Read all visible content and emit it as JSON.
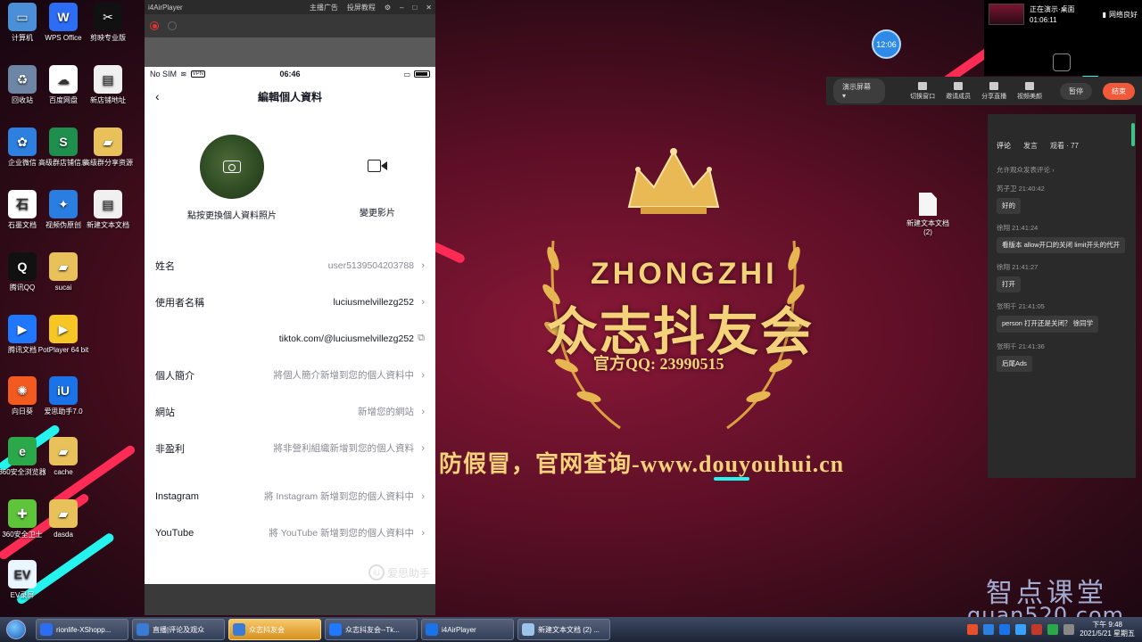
{
  "desktop_icons": [
    {
      "label": "计算机",
      "color": "#4a8fd8",
      "glyph": "▭"
    },
    {
      "label": "WPS Office",
      "color": "#2d6df6",
      "glyph": "W"
    },
    {
      "label": "剪映专业版",
      "color": "#111111",
      "glyph": "✂"
    },
    {
      "label": "回收站",
      "color": "#6e86a6",
      "glyph": "♻"
    },
    {
      "label": "百度网盘",
      "color": "#ffffff",
      "glyph": "☁"
    },
    {
      "label": "新店铺地址",
      "color": "#f0f0f0",
      "glyph": "▤"
    },
    {
      "label": "企业微信",
      "color": "#2d7fe0",
      "glyph": "✿"
    },
    {
      "label": "高级群店铺信息",
      "color": "#1e8f4c",
      "glyph": "S"
    },
    {
      "label": "高级群分享资源",
      "color": "#e8c15a",
      "glyph": "▰"
    },
    {
      "label": "石墨文档",
      "color": "#ffffff",
      "glyph": "石"
    },
    {
      "label": "视频伪原创",
      "color": "#2a7de1",
      "glyph": "✦"
    },
    {
      "label": "新建文本文档",
      "color": "#f0f0f0",
      "glyph": "▤"
    },
    {
      "label": "腾讯QQ",
      "color": "#111111",
      "glyph": "Q"
    },
    {
      "label": "sucai",
      "color": "#e8c15a",
      "glyph": "▰"
    },
    {
      "label": "腾讯文档",
      "color": "#1f78ff",
      "glyph": "▶"
    },
    {
      "label": "PotPlayer 64 bit",
      "color": "#f6c624",
      "glyph": "▶"
    },
    {
      "label": "向日葵",
      "color": "#f25a1f",
      "glyph": "✺"
    },
    {
      "label": "爱思助手7.0",
      "color": "#1a73e8",
      "glyph": "iU"
    },
    {
      "label": "360安全浏览器",
      "color": "#2aa84a",
      "glyph": "e"
    },
    {
      "label": "cache",
      "color": "#e8c15a",
      "glyph": "▰"
    },
    {
      "label": "360安全卫士",
      "color": "#5ec43a",
      "glyph": "✚"
    },
    {
      "label": "dasda",
      "color": "#e8c15a",
      "glyph": "▰"
    },
    {
      "label": "EV录屏",
      "color": "#eaf6ff",
      "glyph": "EV"
    }
  ],
  "airplayer": {
    "title": "i4AirPlayer",
    "menu": [
      "主播广告",
      "投屏教程"
    ]
  },
  "phone": {
    "status": {
      "carrier": "No SIM",
      "vpn": "VPN",
      "time": "06:46"
    },
    "nav_title": "編輯個人資料",
    "avatar_label": "點按更換個人資料照片",
    "video_label": "變更影片",
    "fields": [
      {
        "label": "姓名",
        "value": "user5139504203788",
        "dark": false
      },
      {
        "label": "使用者名稱",
        "value": "luciusmelvillezg252",
        "dark": true
      },
      {
        "label": "",
        "value": "tiktok.com/@luciusmelvillezg252",
        "dark": true,
        "copy": true
      },
      {
        "label": "個人簡介",
        "value": "將個人簡介新增到您的個人資料中",
        "dark": false
      },
      {
        "label": "網站",
        "value": "新增您的網站",
        "dark": false
      },
      {
        "label": "非盈利",
        "value": "將非營利組織新增到您的個人資料",
        "dark": false
      }
    ],
    "social_fields": [
      {
        "label": "Instagram",
        "value": "將 Instagram 新增到您的個人資料中"
      },
      {
        "label": "YouTube",
        "value": "將 YouTube 新增到您的個人資料中"
      }
    ],
    "watermark": "爱思助手"
  },
  "logo": {
    "brand_en": "ZHONGZHI",
    "brand_cn": "众志抖友会",
    "qq": "官方QQ: 23990515",
    "url_line": "防假冒，官网查询-www.douyouhui.cn"
  },
  "live": {
    "status": "正在演示·桌面",
    "timer": "01:06:11",
    "network": "网络良好",
    "clock": "12:06",
    "screen_button": "演示屏幕 ▾",
    "controls": [
      "切换窗口",
      "邀请成员",
      "分享直播",
      "视频美颜"
    ],
    "pause": "暂停",
    "end": "结束"
  },
  "comments": {
    "tabs": [
      "评论",
      "发言",
      "观看 · 77"
    ],
    "allow": "允许观众发表评论 ›",
    "items": [
      {
        "user": "芮子卫",
        "time": "21:40:42",
        "text": "好的"
      },
      {
        "user": "徐翔",
        "time": "21:41:24",
        "text": "看版本 allow开口的关闭  limit开头的代开"
      },
      {
        "user": "徐翔",
        "time": "21:41:27",
        "text": "打开"
      },
      {
        "user": "张明千",
        "time": "21:41:05",
        "text": "person 打开还是关闭？ 徐同学"
      },
      {
        "user": "张明千",
        "time": "21:41:36",
        "text": "后尾Ads"
      }
    ]
  },
  "right_file": {
    "label": "新建文本文档 (2)"
  },
  "brand_watermark": {
    "cn": "智点课堂",
    "url": "quan520.com"
  },
  "taskbar": {
    "items": [
      {
        "label": "rionlife-XShopp...",
        "color": "#2d6df6",
        "active": false
      },
      {
        "label": "直播|评论及观众",
        "color": "#3a7bd5",
        "active": false
      },
      {
        "label": "众志抖友会",
        "color": "#3a7bd5",
        "active": true
      },
      {
        "label": "众志抖友会--Tk...",
        "color": "#1f78ff",
        "active": false
      },
      {
        "label": "i4AirPlayer",
        "color": "#1a73e8",
        "active": false
      },
      {
        "label": "新建文本文档 (2) ...",
        "color": "#9cc3ec",
        "active": false
      }
    ],
    "time": "下午 9:48",
    "date": "2021/5/21 星期五"
  }
}
